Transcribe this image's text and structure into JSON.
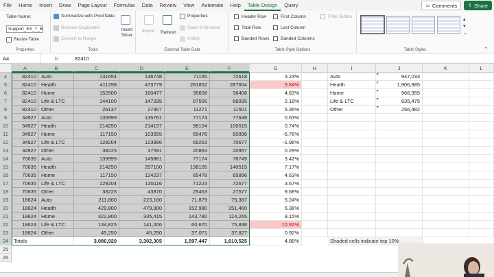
{
  "menubar": {
    "items": [
      "File",
      "Home",
      "Insert",
      "Draw",
      "Page Layout",
      "Formulas",
      "Data",
      "Review",
      "View",
      "Automate",
      "Help",
      "Table Design",
      "Query"
    ],
    "active": "Table Design",
    "comments_label": "Comments",
    "share_label": "Share"
  },
  "ribbon": {
    "properties": {
      "table_name_label": "Table Name:",
      "table_name_value": "Support_EX_7_Bran",
      "resize_label": "Resize Table",
      "group_label": "Properties"
    },
    "tools": {
      "summarize": "Summarize with PivotTable",
      "remove_dupes": "Remove Duplicates",
      "convert": "Convert to Range",
      "insert_slicer": "Insert Slicer",
      "group_label": "Tools"
    },
    "external": {
      "export": "Export",
      "refresh": "Refresh",
      "properties": "Properties",
      "open_browser": "Open in Browser",
      "unlink": "Unlink",
      "group_label": "External Table Data"
    },
    "style_options": {
      "header_row": "Header Row",
      "total_row": "Total Row",
      "banded_rows": "Banded Rows",
      "first_column": "First Column",
      "last_column": "Last Column",
      "banded_columns": "Banded Columns",
      "filter_button": "Filter Button",
      "group_label": "Table Style Options"
    },
    "styles": {
      "group_label": "Table Styles"
    }
  },
  "formula_bar": {
    "name_box": "A4",
    "fx": "fx",
    "value": "82410"
  },
  "sheet": {
    "columns": [
      "A",
      "B",
      "C",
      "D",
      "E",
      "F",
      "G",
      "H",
      "I",
      "J",
      "K",
      "L"
    ],
    "rows": [
      {
        "num": "4",
        "a": "82410",
        "b": "Auto",
        "c": "131654",
        "d": "136748",
        "e": "71165",
        "f": "72618",
        "g": "3.23%",
        "i": "Auto",
        "j": "947,033"
      },
      {
        "num": "5",
        "a": "82410",
        "b": "Health",
        "c": "411298",
        "d": "473779",
        "e": "281852",
        "f": "287604",
        "g": "9.84%",
        "i": "Health",
        "j": "1,906,885"
      },
      {
        "num": "6",
        "a": "82410",
        "b": "Home",
        "c": "152500",
        "d": "160477",
        "e": "35608",
        "f": "36408",
        "g": "4.63%",
        "i": "Home",
        "j": "966,955"
      },
      {
        "num": "7",
        "a": "82410",
        "b": "Life & LTC",
        "c": "144100",
        "d": "147335",
        "e": "67556",
        "f": "68935",
        "g": "2.18%",
        "i": "Life & LTC",
        "j": "835,475"
      },
      {
        "num": "8",
        "a": "82410",
        "b": "Other",
        "c": "26137",
        "d": "27907",
        "e": "11271",
        "f": "11501",
        "g": "5.35%",
        "i": "Other",
        "j": "256,482"
      },
      {
        "num": "9",
        "a": "34927",
        "b": "Auto",
        "c": "135999",
        "d": "135761",
        "e": "77174",
        "f": "77649",
        "g": "0.63%",
        "i": "",
        "j": ""
      },
      {
        "num": "10",
        "a": "34927",
        "b": "Health",
        "c": "214250",
        "d": "214157",
        "e": "98104",
        "f": "100515",
        "g": "0.74%",
        "i": "",
        "j": ""
      },
      {
        "num": "11",
        "a": "34927",
        "b": "Home",
        "c": "117150",
        "d": "103555",
        "e": "65478",
        "f": "65896",
        "g": "-6.76%",
        "i": "",
        "j": ""
      },
      {
        "num": "12",
        "a": "34927",
        "b": "Life & LTC",
        "c": "129204",
        "d": "123896",
        "e": "69263",
        "f": "70677",
        "g": "-1.96%",
        "i": "",
        "j": ""
      },
      {
        "num": "13",
        "a": "34927",
        "b": "Other",
        "c": "38225",
        "d": "37591",
        "e": "20863",
        "f": "20957",
        "g": "0.29%",
        "i": "",
        "j": ""
      },
      {
        "num": "14",
        "a": "70635",
        "b": "Auto",
        "c": "139999",
        "d": "145861",
        "e": "77174",
        "f": "78749",
        "g": "3.42%",
        "i": "",
        "j": ""
      },
      {
        "num": "15",
        "a": "70635",
        "b": "Health",
        "c": "214250",
        "d": "257100",
        "e": "138105",
        "f": "140515",
        "g": "7.17%",
        "i": "",
        "j": ""
      },
      {
        "num": "16",
        "a": "70635",
        "b": "Home",
        "c": "117150",
        "d": "124237",
        "e": "65478",
        "f": "65896",
        "g": "4.63%",
        "i": "",
        "j": ""
      },
      {
        "num": "17",
        "a": "70635",
        "b": "Life & LTC",
        "c": "129204",
        "d": "135116",
        "e": "71223",
        "f": "72677",
        "g": "3.67%",
        "i": "",
        "j": ""
      },
      {
        "num": "18",
        "a": "70635",
        "b": "Other",
        "c": "38225",
        "d": "43870",
        "e": "25463",
        "f": "27577",
        "g": "9.68%",
        "i": "",
        "j": ""
      },
      {
        "num": "19",
        "a": "18624",
        "b": "Auto",
        "c": "211,800",
        "d": "223,160",
        "e": "71,879",
        "f": "75,387",
        "g": "5.24%",
        "i": "",
        "j": ""
      },
      {
        "num": "20",
        "a": "18624",
        "b": "Health",
        "c": "429,800",
        "d": "479,900",
        "e": "152,980",
        "f": "151,460",
        "g": "6.38%",
        "i": "",
        "j": ""
      },
      {
        "num": "21",
        "a": "18624",
        "b": "Home",
        "c": "322,800",
        "d": "335,415",
        "e": "143,780",
        "f": "114,265",
        "g": "8.15%",
        "i": "",
        "j": ""
      },
      {
        "num": "22",
        "a": "18624",
        "b": "Life & LTC",
        "c": "134,825",
        "d": "141,006",
        "e": "60,670",
        "f": "75,838",
        "g": "10.92%",
        "i": "",
        "j": ""
      },
      {
        "num": "23",
        "a": "18624",
        "b": "Other",
        "c": "45,250",
        "d": "45,250",
        "e": "37,071",
        "f": "37,827",
        "g": "0.92%",
        "i": "",
        "j": ""
      }
    ],
    "totals_row": {
      "num": "24",
      "a": "Totals",
      "c": "3,086,920",
      "d": "3,302,305",
      "e": "1,597,447",
      "f": "1,610,525",
      "g": "4.88%",
      "note": "Shaded cells indicate top 10%"
    },
    "empty_rows": [
      "25",
      "26"
    ],
    "pink_rows": [
      "5",
      "22"
    ]
  },
  "colors": {
    "accent": "#1e7145",
    "table_fill": "#cfd1cf",
    "highlight": "#f8c9c9"
  }
}
